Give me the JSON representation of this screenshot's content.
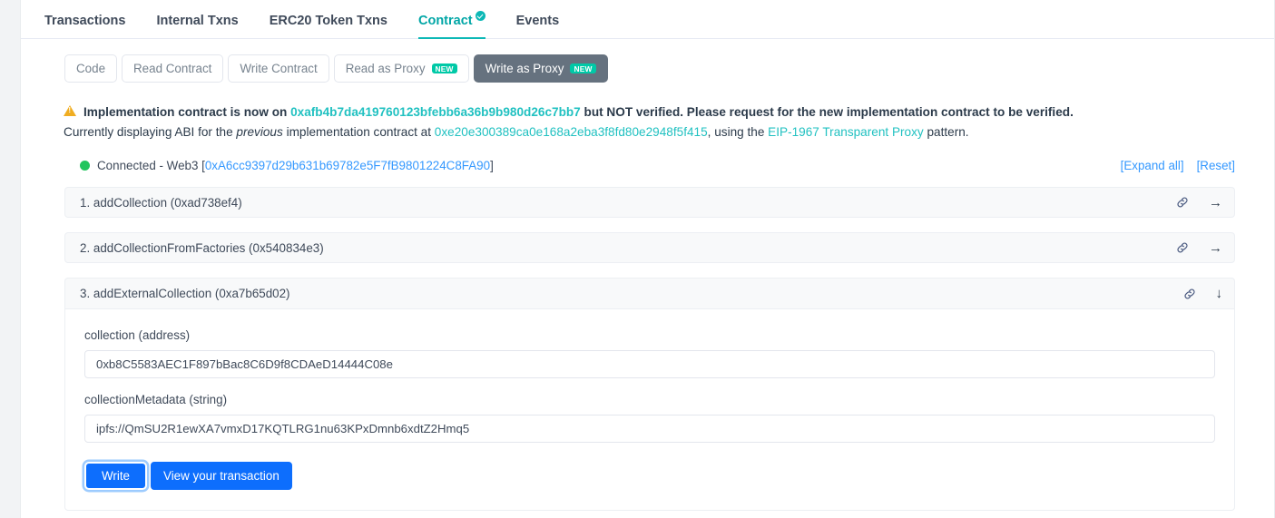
{
  "tabs": [
    {
      "label": "Transactions",
      "active": false,
      "verified": false
    },
    {
      "label": "Internal Txns",
      "active": false,
      "verified": false
    },
    {
      "label": "ERC20 Token Txns",
      "active": false,
      "verified": false
    },
    {
      "label": "Contract",
      "active": true,
      "verified": true
    },
    {
      "label": "Events",
      "active": false,
      "verified": false
    }
  ],
  "subnav": [
    {
      "label": "Code",
      "active": false,
      "badge": null
    },
    {
      "label": "Read Contract",
      "active": false,
      "badge": null
    },
    {
      "label": "Write Contract",
      "active": false,
      "badge": null
    },
    {
      "label": "Read as Proxy",
      "active": false,
      "badge": "NEW"
    },
    {
      "label": "Write as Proxy",
      "active": true,
      "badge": "NEW"
    }
  ],
  "warning": {
    "line1_prefix": "Implementation contract is now on ",
    "line1_address": "0xafb4b7da419760123bfebb6a36b9b980d26c7bb7",
    "line1_suffix": " but NOT verified. Please request for the new implementation contract to be verified.",
    "line2_prefix": "Currently displaying ABI for the ",
    "line2_italic": "previous",
    "line2_mid": " implementation contract at ",
    "line2_address": "0xe20e300389ca0e168a2eba3f8fd80e2948f5f415",
    "line2_mid2": ", using the ",
    "line2_eip_link": "EIP-1967 Transparent Proxy",
    "line2_suffix": " pattern."
  },
  "connection": {
    "status_text": "Connected - Web3 [",
    "address": "0xA6cc9397d29b631b69782e5F7fB9801224C8FA90",
    "close_bracket": "]",
    "expand_all": "[Expand all]",
    "reset": "[Reset]"
  },
  "functions": [
    {
      "title": "1. addCollection (0xad738ef4)",
      "expanded": false,
      "arrow": "→"
    },
    {
      "title": "2. addCollectionFromFactories (0x540834e3)",
      "expanded": false,
      "arrow": "→"
    },
    {
      "title": "3. addExternalCollection (0xa7b65d02)",
      "expanded": true,
      "arrow": "↓",
      "fields": [
        {
          "label": "collection (address)",
          "value": "0xb8C5583AEC1F897bBac8C6D9f8CDAeD14444C08e",
          "placeholder": "collection (address)"
        },
        {
          "label": "collectionMetadata (string)",
          "value": "ipfs://QmSU2R1ewXA7vmxD17KQTLRG1nu63KPxDmnb6xdtZ2Hmq5",
          "placeholder": "collectionMetadata (string)"
        }
      ],
      "write_label": "Write",
      "view_label": "View your transaction"
    }
  ],
  "colors": {
    "accent_teal": "#0cb8b6",
    "link_teal": "#21c1c1",
    "link_blue": "#3498ff",
    "primary_blue": "#0d6efd",
    "badge_green": "#00c9a7",
    "status_green": "#21c55d",
    "warning_amber": "#f0ad21",
    "active_button_gray": "#66727f"
  }
}
